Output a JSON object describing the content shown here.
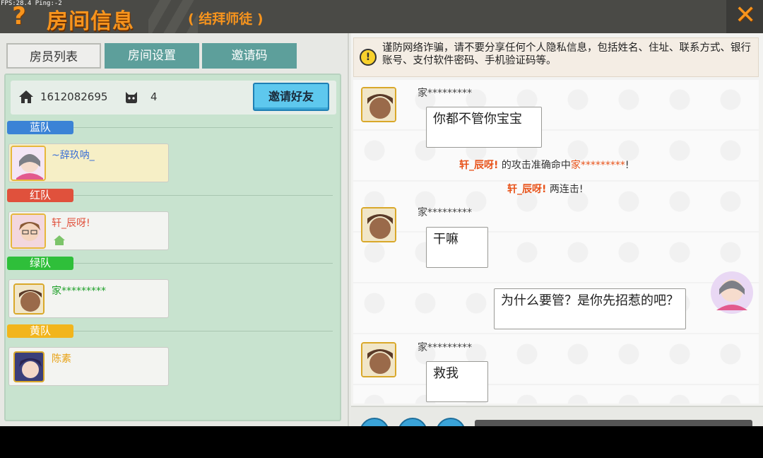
{
  "debug": {
    "fps_text": "FPS:28.4  Ping:-2"
  },
  "header": {
    "title": "房间信息",
    "subtitle": "( 结拜师徒 )",
    "help_glyph": "?",
    "close_glyph": "✕"
  },
  "tabs": [
    {
      "label": "房员列表",
      "active": true
    },
    {
      "label": "房间设置"
    },
    {
      "label": "邀请码"
    }
  ],
  "room": {
    "id": "1612082695",
    "player_count": "4",
    "invite_label": "邀请好友"
  },
  "teams": [
    {
      "label": "蓝队",
      "color": "#3b83d6",
      "member": {
        "name": "~辞玖呐_",
        "name_color": "#3b6fd6",
        "highlight": true
      }
    },
    {
      "label": "红队",
      "color": "#e0513c",
      "member": {
        "name": "轩_辰呀!",
        "name_color": "#e0513c"
      }
    },
    {
      "label": "绿队",
      "color": "#2fbf3a",
      "member": {
        "name": "家*********",
        "name_color": "#1fa02a"
      }
    },
    {
      "label": "黄队",
      "color": "#f2b51c",
      "member": {
        "name": "陈素",
        "name_color": "#e8a215"
      }
    }
  ],
  "notice": {
    "icon": "warning-icon",
    "text": "谨防网络诈骗，请不要分享任何个人隐私信息，包括姓名、住址、联系方式、银行账号、支付软件密码、手机验证码等。"
  },
  "chat": {
    "messages": [
      {
        "sender": "家*********",
        "text": "你都不管你宝宝"
      },
      {
        "sender": "家*********",
        "text": "干嘛"
      },
      {
        "sender": "",
        "text": "为什么要管？是你先招惹的吧？",
        "self": true
      },
      {
        "sender": "家*********",
        "text": "救我"
      }
    ],
    "system": [
      {
        "actor": "轩_辰呀!",
        "middle": " 的攻击准确命中",
        "target": "家*********",
        "end": "!"
      },
      {
        "actor": "轩_辰呀!",
        "middle": " 两连击!",
        "target": "",
        "end": ""
      }
    ]
  },
  "colors": {
    "accent": "#f7941d",
    "tab_inactive": "#5d9f9b",
    "invite_button": "#5ec8ee"
  }
}
